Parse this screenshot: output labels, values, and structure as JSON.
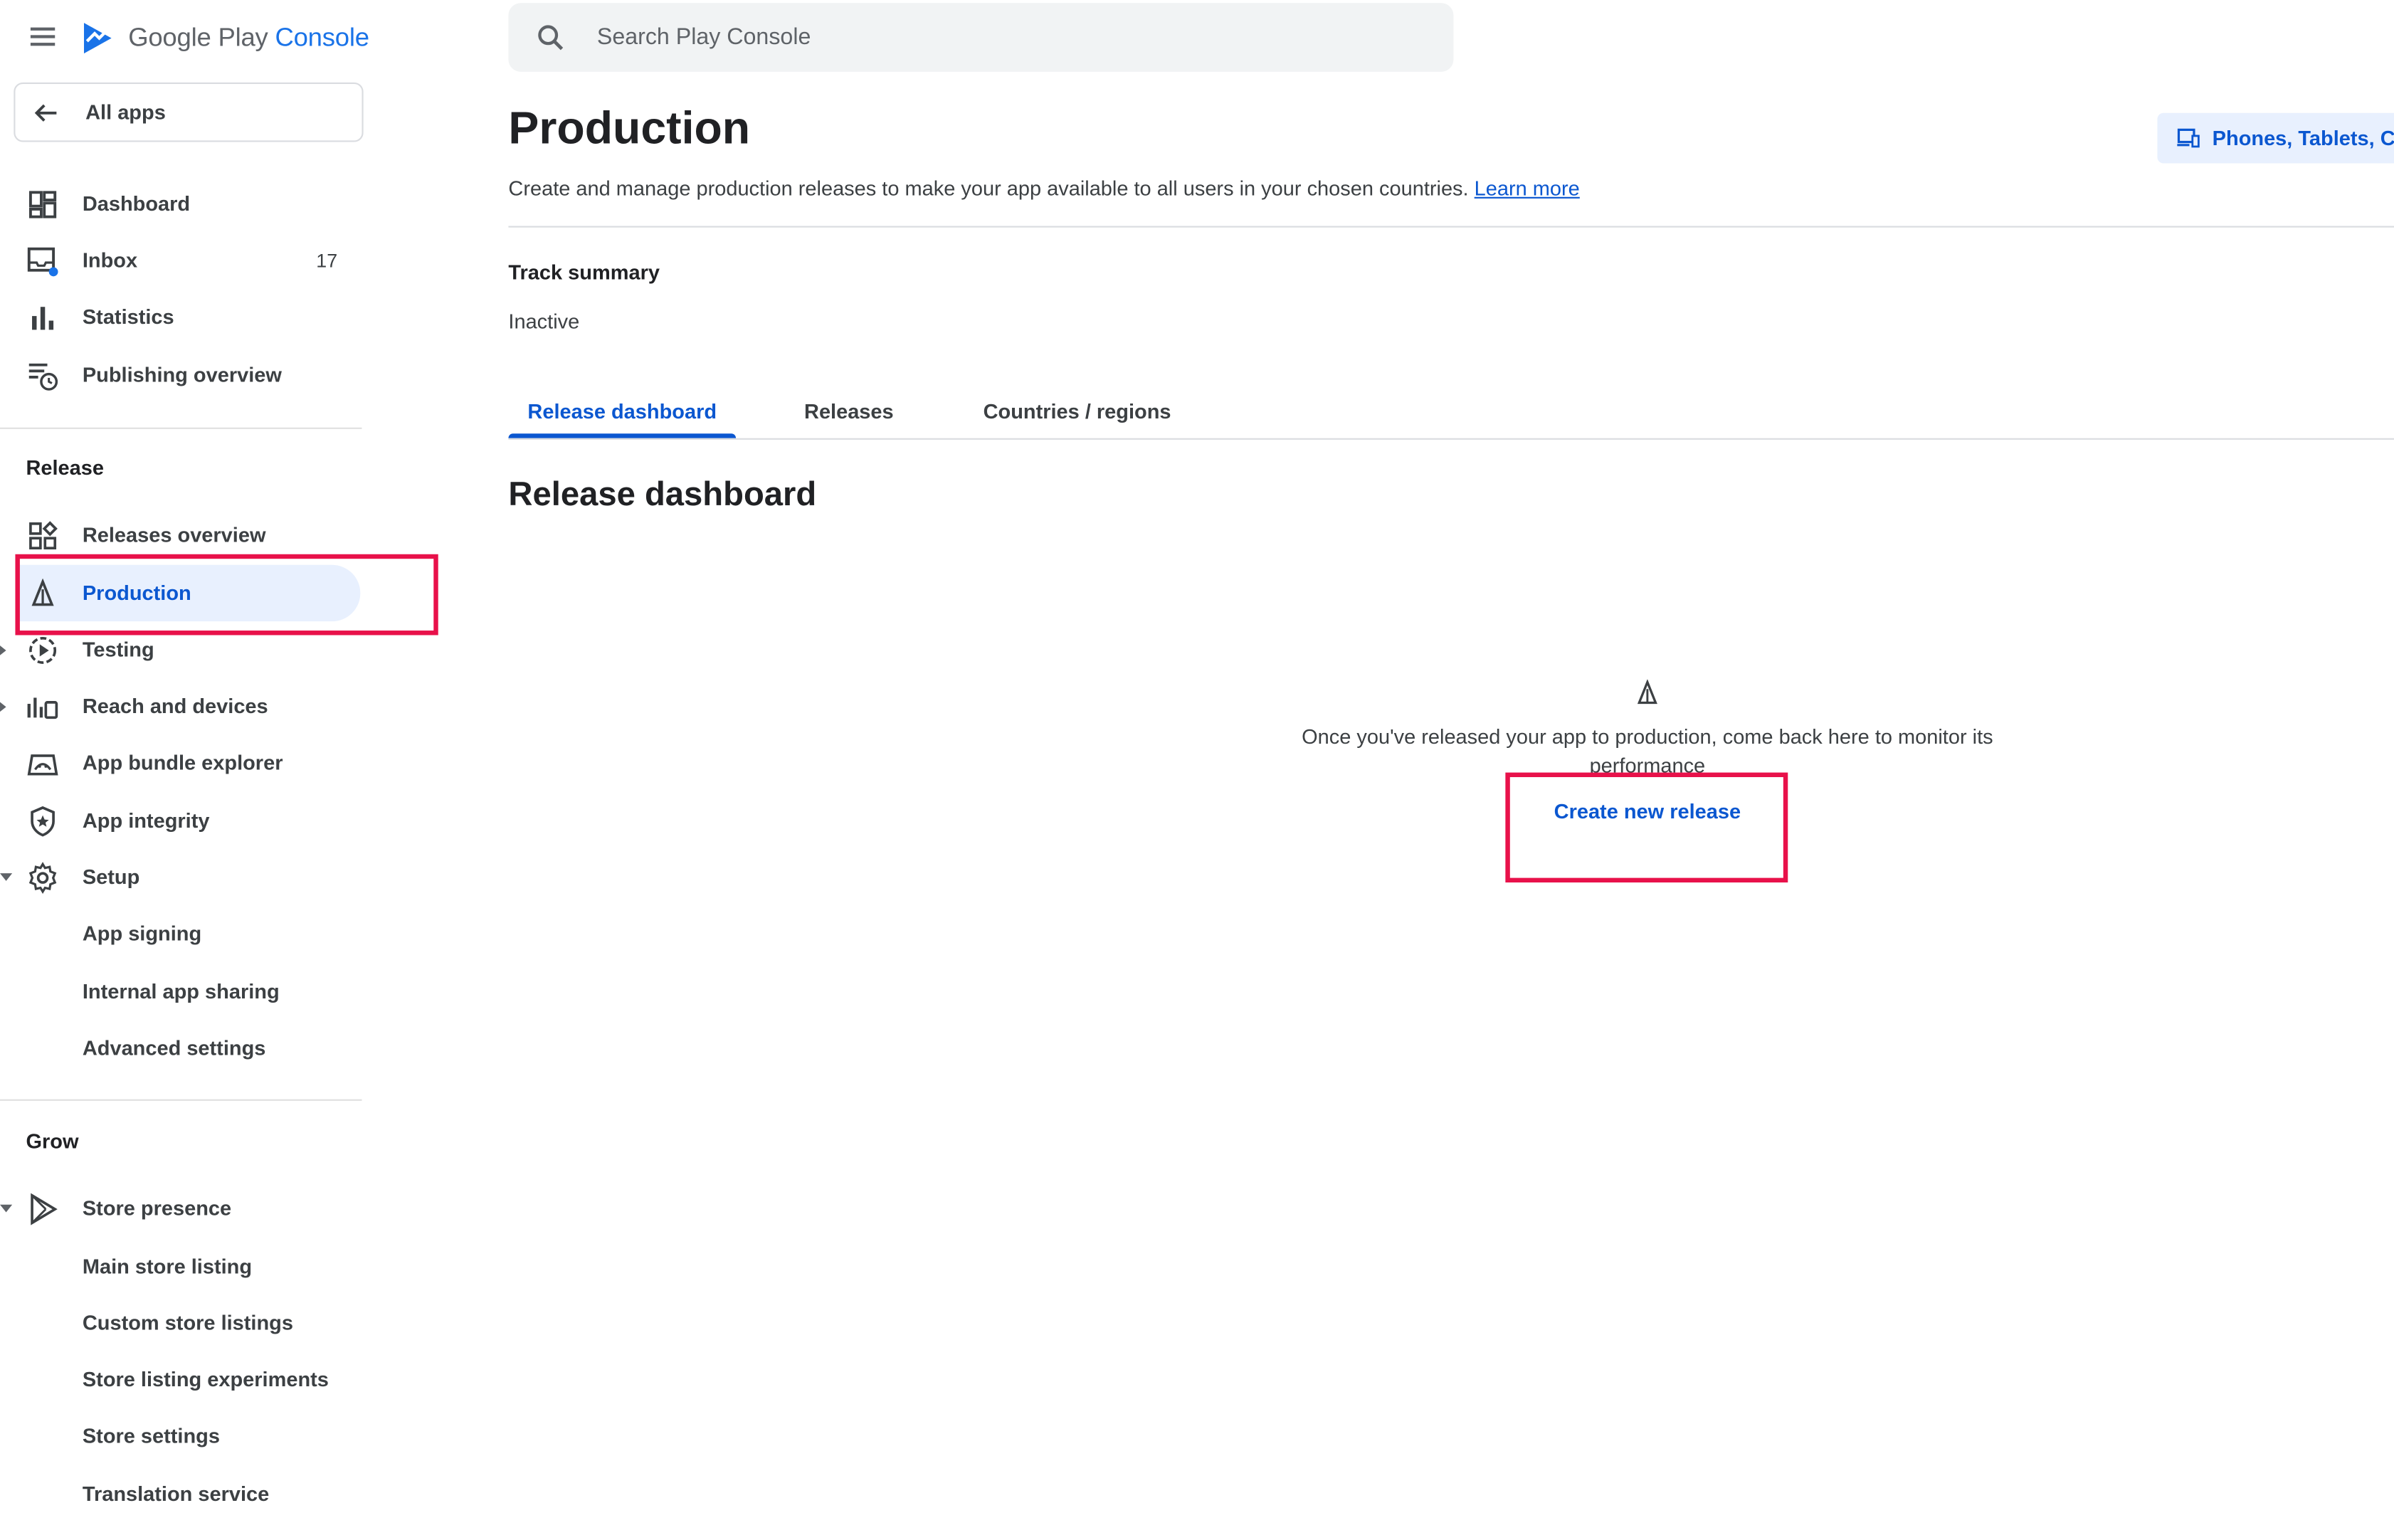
{
  "header": {
    "logo_text_1": "Google Play",
    "logo_text_2": "Console",
    "search_placeholder": "Search Play Console"
  },
  "sidebar": {
    "all_apps": "All apps",
    "items_top": [
      {
        "label": "Dashboard",
        "icon": "dashboard-icon"
      },
      {
        "label": "Inbox",
        "icon": "inbox-icon",
        "count": "17"
      },
      {
        "label": "Statistics",
        "icon": "bar-chart-icon"
      },
      {
        "label": "Publishing overview",
        "icon": "publishing-overview-icon"
      }
    ],
    "release_section": "Release",
    "release_items": [
      {
        "label": "Releases overview",
        "icon": "releases-overview-icon"
      },
      {
        "label": "Production",
        "icon": "production-icon"
      },
      {
        "label": "Testing",
        "icon": "testing-icon"
      },
      {
        "label": "Reach and devices",
        "icon": "reach-devices-icon"
      },
      {
        "label": "App bundle explorer",
        "icon": "app-bundle-icon"
      },
      {
        "label": "App integrity",
        "icon": "shield-icon"
      },
      {
        "label": "Setup",
        "icon": "gear-icon"
      },
      {
        "label": "App signing"
      },
      {
        "label": "Internal app sharing"
      },
      {
        "label": "Advanced settings"
      }
    ],
    "grow_section": "Grow",
    "grow_items": [
      {
        "label": "Store presence",
        "icon": "play-store-icon"
      },
      {
        "label": "Main store listing"
      },
      {
        "label": "Custom store listings"
      },
      {
        "label": "Store listing experiments"
      },
      {
        "label": "Store settings"
      },
      {
        "label": "Translation service"
      }
    ]
  },
  "main": {
    "title": "Production",
    "description": "Create and manage production releases to make your app available to all users in your chosen countries.",
    "learn_more": "Learn more",
    "device_button": "Phones, Tablets, Ch",
    "track_summary_title": "Track summary",
    "track_status": "Inactive",
    "tabs": [
      {
        "label": "Release dashboard",
        "active": true
      },
      {
        "label": "Releases",
        "active": false
      },
      {
        "label": "Countries / regions",
        "active": false
      }
    ],
    "section_title": "Release dashboard",
    "empty_state_text": "Once you've released your app to production, come back here to monitor its performance",
    "create_release": "Create new release"
  },
  "colors": {
    "accent": "#0b57d0",
    "active_bg": "#e8f0fe",
    "highlight_box": "#e8114a"
  }
}
